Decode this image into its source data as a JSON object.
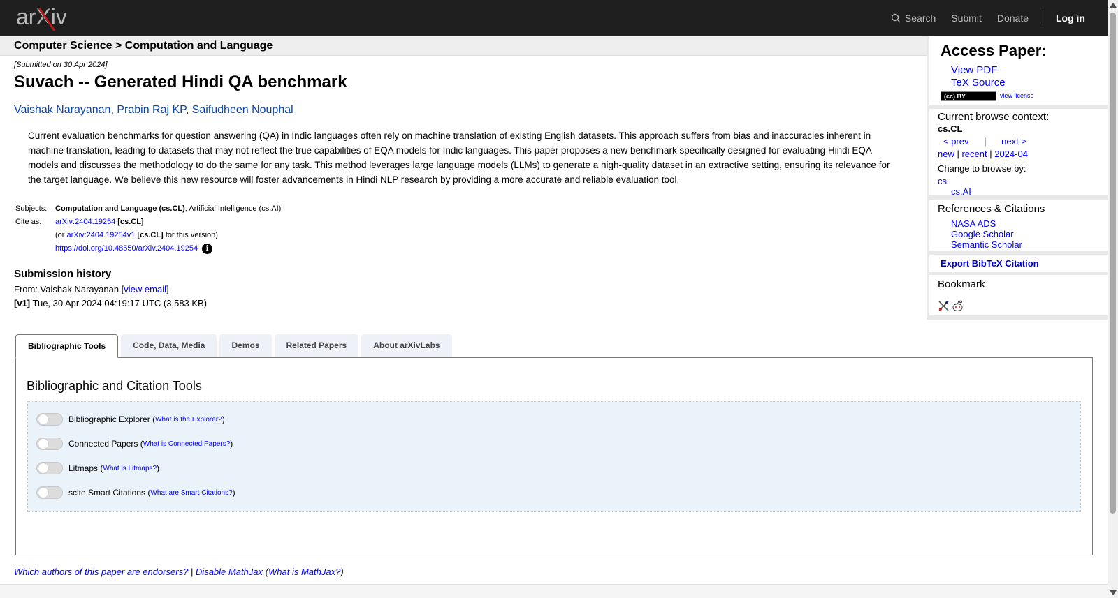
{
  "header": {
    "logo_text": "arXiv",
    "search_label": "Search",
    "submit_label": "Submit",
    "donate_label": "Donate",
    "login_label": "Log in"
  },
  "breadcrumb": "Computer Science > Computation and Language",
  "paper": {
    "submitted": "[Submitted on 30 Apr 2024]",
    "title": "Suvach -- Generated Hindi QA benchmark",
    "authors": [
      "Vaishak Narayanan",
      "Prabin Raj KP",
      "Saifudheen Nouphal"
    ],
    "author_sep": ", ",
    "abstract": "Current evaluation benchmarks for question answering (QA) in Indic languages often rely on machine translation of existing English datasets. This approach suffers from bias and inaccuracies inherent in machine translation, leading to datasets that may not reflect the true capabilities of EQA models for Indic languages. This paper proposes a new benchmark specifically designed for evaluating Hindi EQA models and discusses the methodology to do the same for any task. This method leverages large language models (LLMs) to generate a high-quality dataset in an extractive setting, ensuring its relevance for the target language. We believe this new resource will foster advancements in Hindi NLP research by providing a more accurate and reliable evaluation tool."
  },
  "metadata": {
    "subjects_label": "Subjects:",
    "subject_primary": "Computation and Language (cs.CL)",
    "subject_secondary": "; Artificial Intelligence (cs.AI)",
    "cite_label": "Cite as:",
    "cite_id": "arXiv:2404.19254",
    "cite_cat": "[cs.CL]",
    "cite_or": "(or ",
    "cite_version_id": "arXiv:2404.19254v1",
    "cite_version_cat": "[cs.CL]",
    "cite_version_suffix": " for this version)",
    "doi": "https://doi.org/10.48550/arXiv.2404.19254",
    "info_glyph": "i"
  },
  "submission_history": {
    "heading": "Submission history",
    "from_prefix": "From: Vaishak Narayanan [",
    "view_email": "view email",
    "from_suffix": "]",
    "version_tag": "[v1]",
    "version_text": " Tue, 30 Apr 2024 04:19:17 UTC (3,583 KB)"
  },
  "tabs": [
    "Bibliographic Tools",
    "Code, Data, Media",
    "Demos",
    "Related Papers",
    "About arXivLabs"
  ],
  "tools_panel": {
    "heading": "Bibliographic and Citation Tools",
    "items": [
      {
        "label": "Bibliographic Explorer",
        "help": "What is the Explorer?"
      },
      {
        "label": "Connected Papers",
        "help": "What is Connected Papers?"
      },
      {
        "label": "Litmaps",
        "help": "What is Litmaps?"
      },
      {
        "label": "scite Smart Citations",
        "help": "What are Smart Citations?"
      }
    ]
  },
  "footer": {
    "endorsers": "Which authors of this paper are endorsers?",
    "pipe": " | ",
    "disable_mathjax": "Disable MathJax",
    "open_paren": " (",
    "what_mathjax": "What is MathJax?",
    "close_paren": ")"
  },
  "sidebar": {
    "access_heading": "Access Paper:",
    "view_pdf": "View PDF",
    "tex_source": "TeX Source",
    "license_badge": "(cc) BY",
    "view_license": "view license",
    "browse_heading": "Current browse context:",
    "browse_context": "cs.CL",
    "prev": "< prev",
    "browse_pipe": "|",
    "next": "next >",
    "new": "new",
    "recent": "recent",
    "month": "2024-04",
    "pipe": " | ",
    "change_browse": "Change to browse by:",
    "browse_cs": "cs",
    "browse_csai": "cs.AI",
    "refs_heading": "References & Citations",
    "nasa_ads": "NASA ADS",
    "google_scholar": "Google Scholar",
    "semantic_scholar": "Semantic Scholar",
    "export_bibtex": "Export BibTeX Citation",
    "bookmark_heading": "Bookmark"
  }
}
